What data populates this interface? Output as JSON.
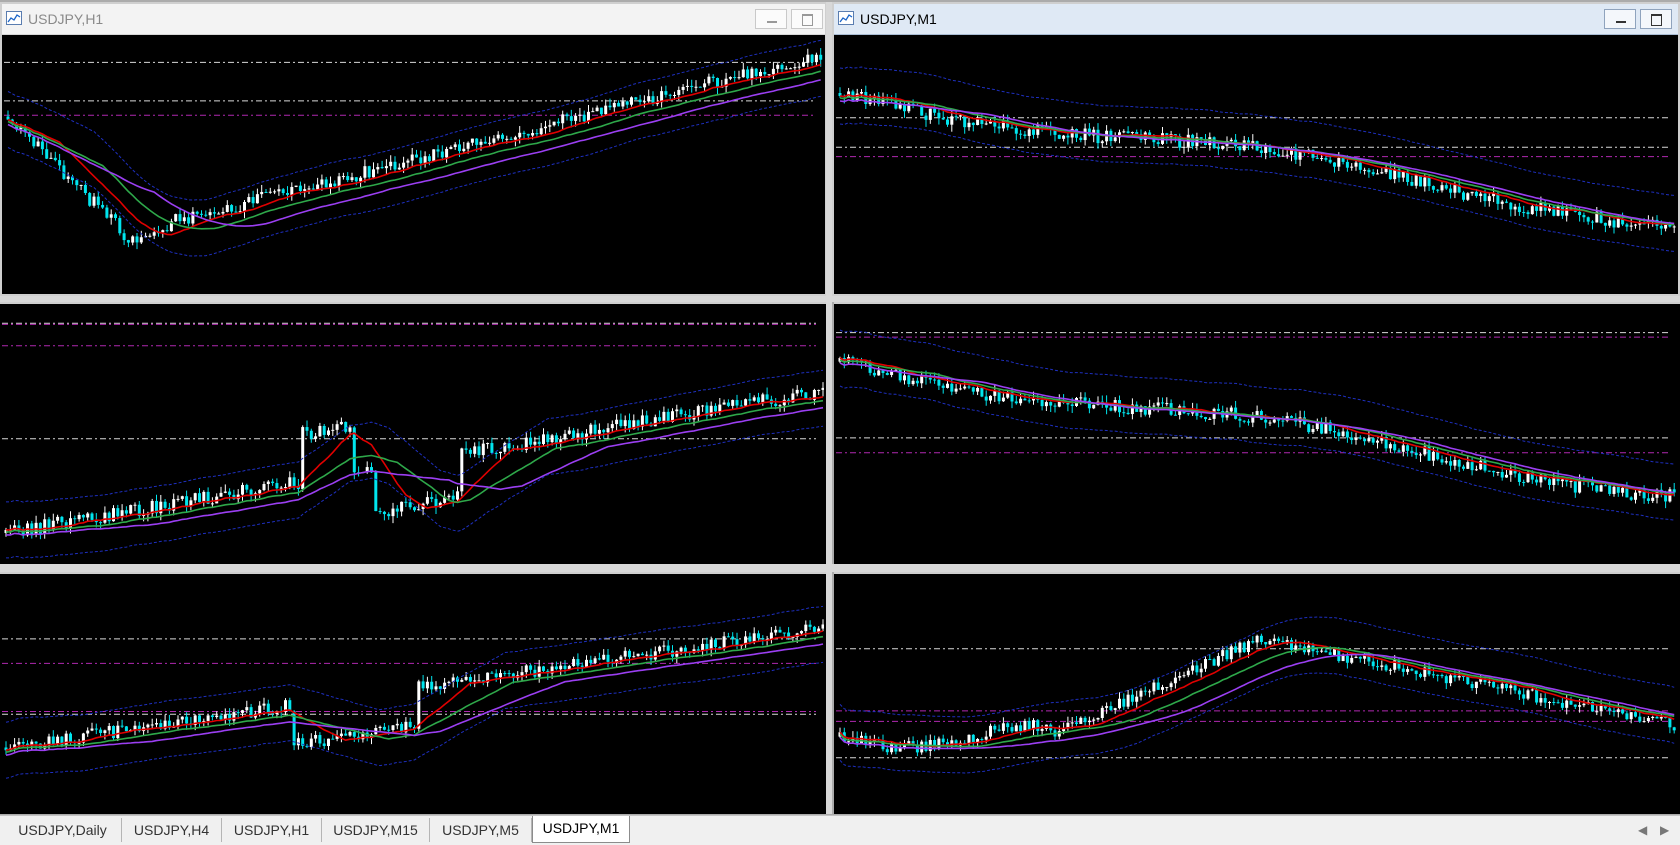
{
  "windows": {
    "h1": {
      "title": "USDJPY,H1"
    },
    "m1": {
      "title": "USDJPY,M1"
    }
  },
  "tabs": [
    {
      "label": "USDJPY,Daily",
      "active": false
    },
    {
      "label": "USDJPY,H4",
      "active": false
    },
    {
      "label": "USDJPY,H1",
      "active": false
    },
    {
      "label": "USDJPY,M15",
      "active": false
    },
    {
      "label": "USDJPY,M5",
      "active": false
    },
    {
      "label": "USDJPY,M1",
      "active": true
    }
  ],
  "icons": {
    "window": "chart-window-icon",
    "minimize": "minimize-icon",
    "maximize": "maximize-icon",
    "scroll_left": "scroll-left-icon",
    "scroll_right": "scroll-right-icon"
  },
  "colors": {
    "chart_bg": "#000000",
    "bull_candle": "#ffffff",
    "bear_candle": "#00e5ee",
    "ma_fast": "#e00000",
    "ma_mid": "#2ea84a",
    "ma_slow": "#9b3ff2",
    "bands": "#1e2fbf",
    "level_white": "#ffffff",
    "level_magenta": "#d030d0"
  }
}
